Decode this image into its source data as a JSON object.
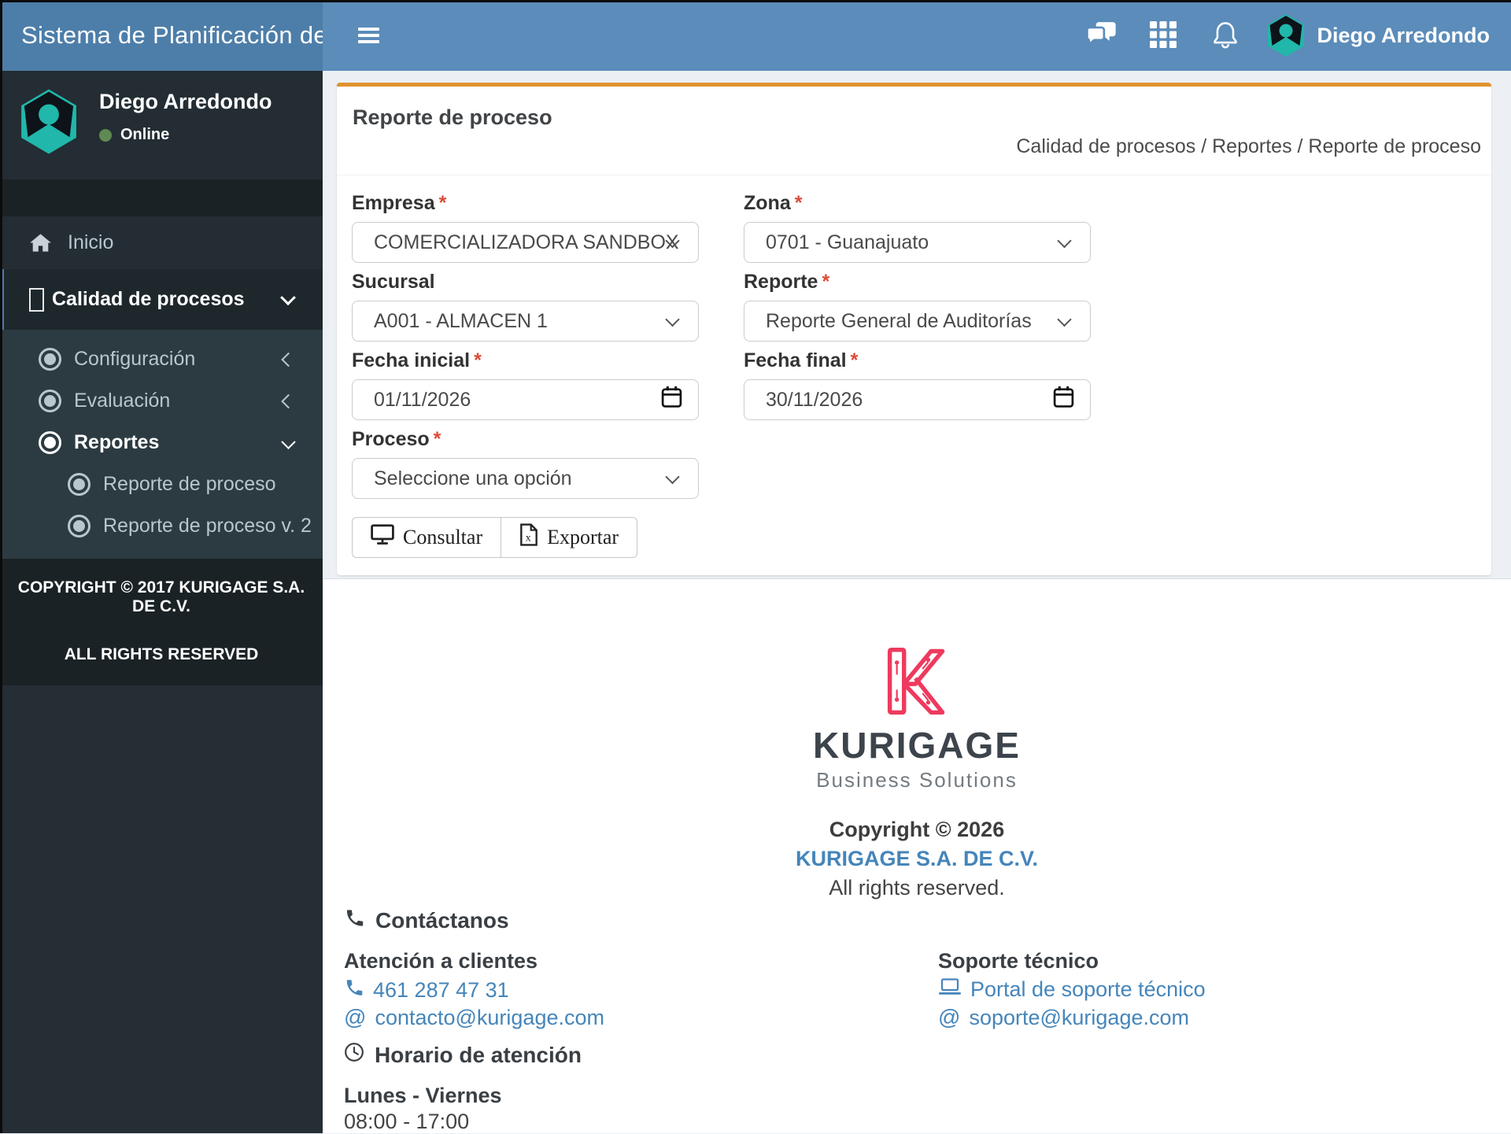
{
  "colors": {
    "navbar_blue": "#5b8cba",
    "logo_blue": "#4d7ea9",
    "accent_orange": "#e0932f",
    "link_blue": "#4585ba",
    "brand_pink": "#ee3a5e",
    "avatar_teal": "#21b7aa",
    "online_green": "#5f8a54"
  },
  "icons": [
    "hamburger-icon",
    "messages-icon",
    "apps-grid-icon",
    "notifications-icon",
    "hexagon-avatar",
    "home-icon",
    "missing-glyph-icon",
    "dot-circle-icon",
    "chevron-down-icon",
    "chevron-left-icon",
    "calendar-icon",
    "desktop-icon",
    "excel-file-icon",
    "phone-icon",
    "at-icon",
    "laptop-icon",
    "clock-icon"
  ],
  "header": {
    "brand": "Sistema de Planificación de",
    "user_name": "Diego Arredondo"
  },
  "sidebar": {
    "user": {
      "name": "Diego Arredondo",
      "status": "Online"
    },
    "menu": [
      {
        "label": "Inicio"
      },
      {
        "label": "Calidad de procesos"
      },
      {
        "label": "Configuración"
      },
      {
        "label": "Evaluación"
      },
      {
        "label": "Reportes"
      },
      {
        "label": "Reporte de proceso"
      },
      {
        "label": "Reporte de proceso v. 2"
      }
    ],
    "copyright_line1": "COPYRIGHT © 2017 KURIGAGE S.A. DE C.V.",
    "copyright_line2": "ALL RIGHTS RESERVED"
  },
  "content": {
    "title": "Reporte de proceso",
    "breadcrumb": "Calidad de procesos / Reportes / Reporte de proceso",
    "form": {
      "required_mark": "*",
      "empresa": {
        "label": "Empresa",
        "value": "COMERCIALIZADORA SANDBOX"
      },
      "zona": {
        "label": "Zona",
        "value": "0701 - Guanajuato"
      },
      "sucursal": {
        "label": "Sucursal",
        "value": "A001 - ALMACEN 1"
      },
      "reporte": {
        "label": "Reporte",
        "value": "Reporte General de Auditorías"
      },
      "fecha_inicial": {
        "label": "Fecha inicial",
        "value": "01/11/2026"
      },
      "fecha_final": {
        "label": "Fecha final",
        "value": "30/11/2026"
      },
      "proceso": {
        "label": "Proceso",
        "value": "Seleccione una opción"
      }
    },
    "buttons": {
      "consultar": "Consultar",
      "exportar": "Exportar"
    }
  },
  "footer": {
    "logo_title": "KURIGAGE",
    "logo_subtitle": "Business Solutions",
    "copyright": "Copyright © 2026",
    "company": "KURIGAGE S.A. DE C.V.",
    "rights": "All rights reserved.",
    "contact_title": "Contáctanos",
    "clients_title": "Atención a clientes",
    "phone": "461 287 47 31",
    "at_prefix": "@",
    "client_email": "contacto@kurigage.com",
    "support_title": "Soporte técnico",
    "support_portal": "Portal de soporte técnico",
    "support_email": "soporte@kurigage.com",
    "schedule_title": "Horario de atención",
    "schedule_days": "Lunes - Viernes",
    "schedule_hours": "08:00 - 17:00"
  }
}
